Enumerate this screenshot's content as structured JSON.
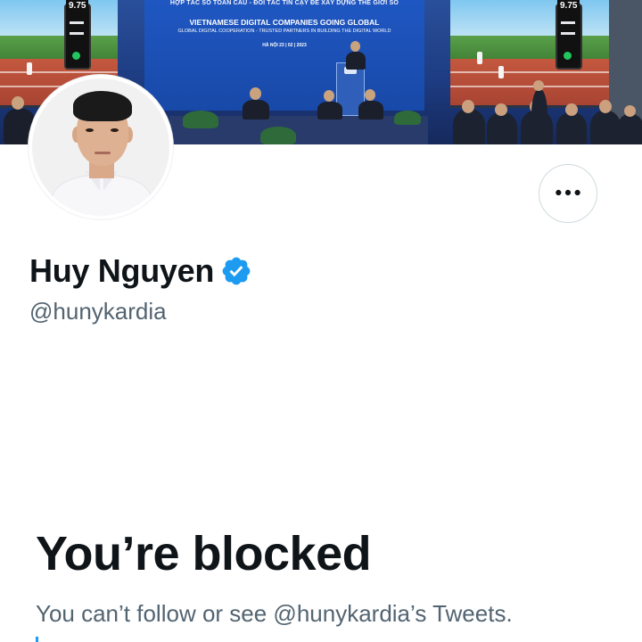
{
  "banner": {
    "screen_title_top": "HỢP TÁC SỐ TOÀN CẦU - ĐỐI TÁC TIN CẬY ĐỂ XÂY DỰNG THẾ GIỚI SỐ",
    "screen_title_main": "VIETNAMESE DIGITAL COMPANIES GOING GLOBAL",
    "screen_subtitle": "GLOBAL DIGITAL COOPERATION - TRUSTED PARTNERS IN BUILDING THE DIGITAL WORLD",
    "screen_date": "HÀ NỘI 23 | 02 | 2023",
    "left_score": "9.75",
    "right_score": "9.75"
  },
  "profile": {
    "display_name": "Huy Nguyen",
    "handle": "@hunykardia",
    "verified": true
  },
  "blocked": {
    "title": "You’re blocked",
    "description": "You can’t follow or see @hunykardia’s Tweets."
  },
  "colors": {
    "text_primary": "#0f1419",
    "text_secondary": "#536471",
    "verified_blue": "#1d9bf0",
    "border": "#cfd9de"
  },
  "icons": {
    "more": "more-horizontal-icon",
    "verified": "verified-badge-icon"
  }
}
